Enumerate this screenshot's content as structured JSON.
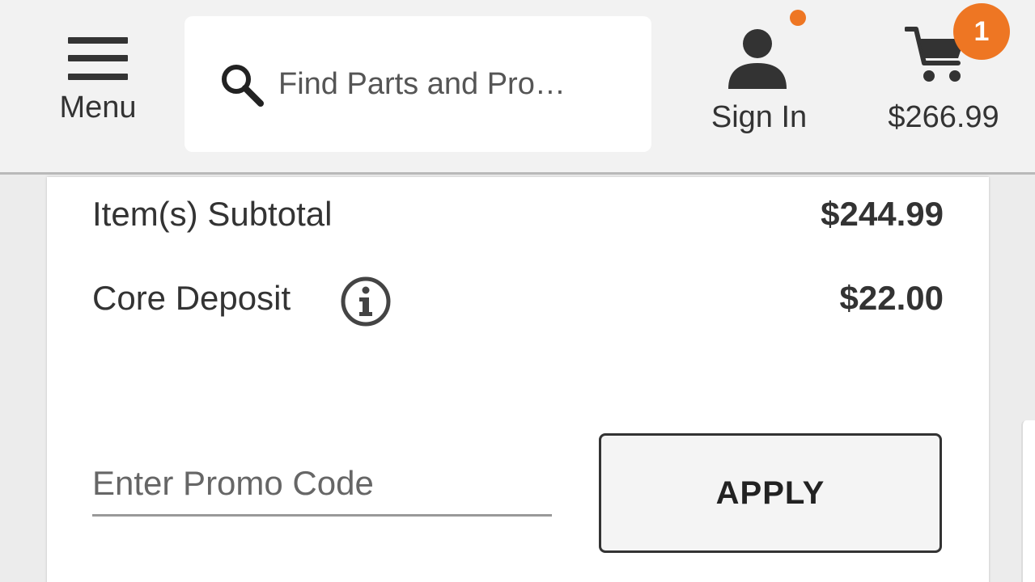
{
  "header": {
    "menu_label": "Menu",
    "search_placeholder": "Find Parts and Pro…",
    "signin_label": "Sign In",
    "cart_count": "1",
    "cart_total": "$266.99"
  },
  "summary": {
    "subtotal_label": "Item(s) Subtotal",
    "subtotal_value": "$244.99",
    "core_label": "Core Deposit",
    "core_value": "$22.00"
  },
  "promo": {
    "placeholder": "Enter Promo Code",
    "apply_label": "APPLY"
  },
  "colors": {
    "accent": "#ee7623",
    "text": "#333333",
    "header_bg": "#f2f2f2"
  },
  "icons": [
    "menu-icon",
    "search-icon",
    "user-icon",
    "cart-icon",
    "info-icon"
  ]
}
